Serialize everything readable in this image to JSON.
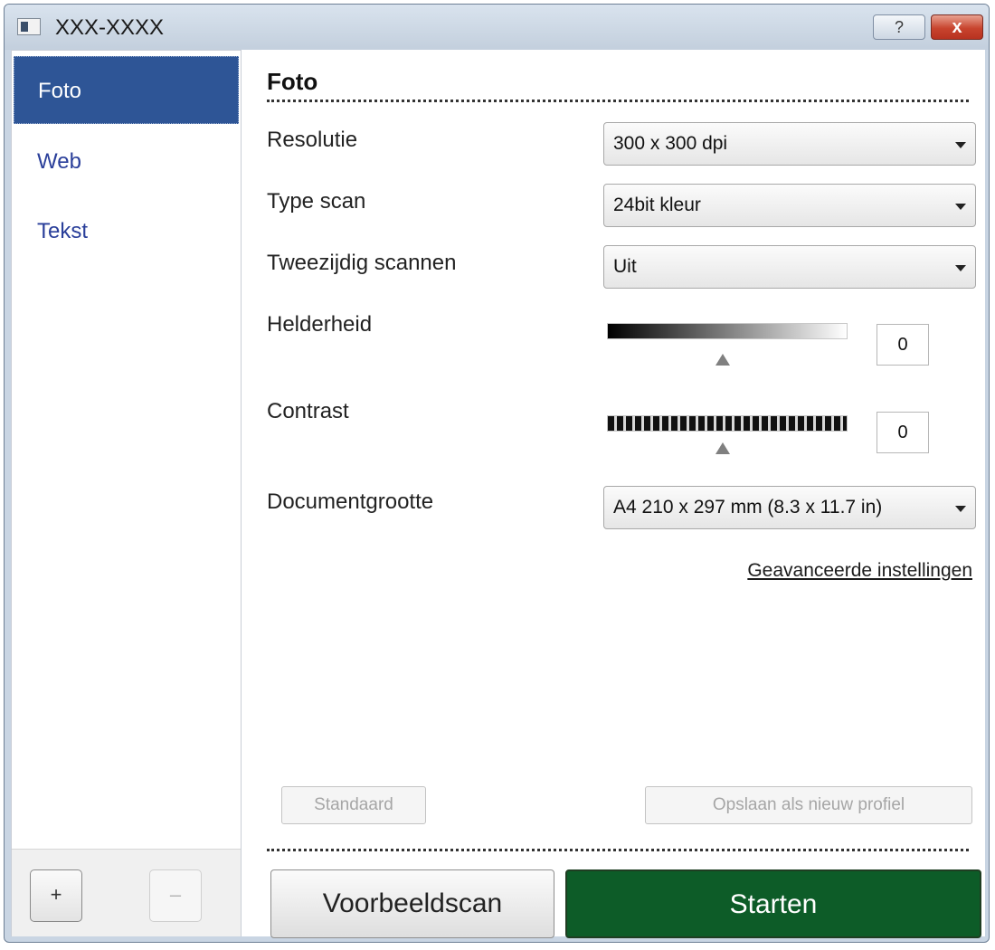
{
  "window": {
    "title": "XXX-XXXX",
    "help_label": "?",
    "close_label": "x"
  },
  "sidebar": {
    "items": [
      {
        "label": "Foto",
        "selected": true
      },
      {
        "label": "Web",
        "selected": false
      },
      {
        "label": "Tekst",
        "selected": false
      }
    ],
    "add_label": "+",
    "remove_label": "–"
  },
  "main": {
    "title": "Foto",
    "resolution": {
      "label": "Resolutie",
      "value": "300 x 300 dpi"
    },
    "scan_type": {
      "label": "Type scan",
      "value": "24bit kleur"
    },
    "duplex": {
      "label": "Tweezijdig scannen",
      "value": "Uit"
    },
    "brightness": {
      "label": "Helderheid",
      "value": "0"
    },
    "contrast": {
      "label": "Contrast",
      "value": "0"
    },
    "doc_size": {
      "label": "Documentgrootte",
      "value": "A4 210 x 297 mm (8.3 x 11.7 in)"
    },
    "advanced_link": "Geavanceerde instellingen",
    "default_button": "Standaard",
    "save_profile_button": "Opslaan als nieuw profiel",
    "preview_button": "Voorbeeldscan",
    "start_button": "Starten"
  },
  "colors": {
    "selected_item": "#2e5596",
    "start_button": "#0d5c28",
    "nav_text": "#2a3f9a"
  }
}
